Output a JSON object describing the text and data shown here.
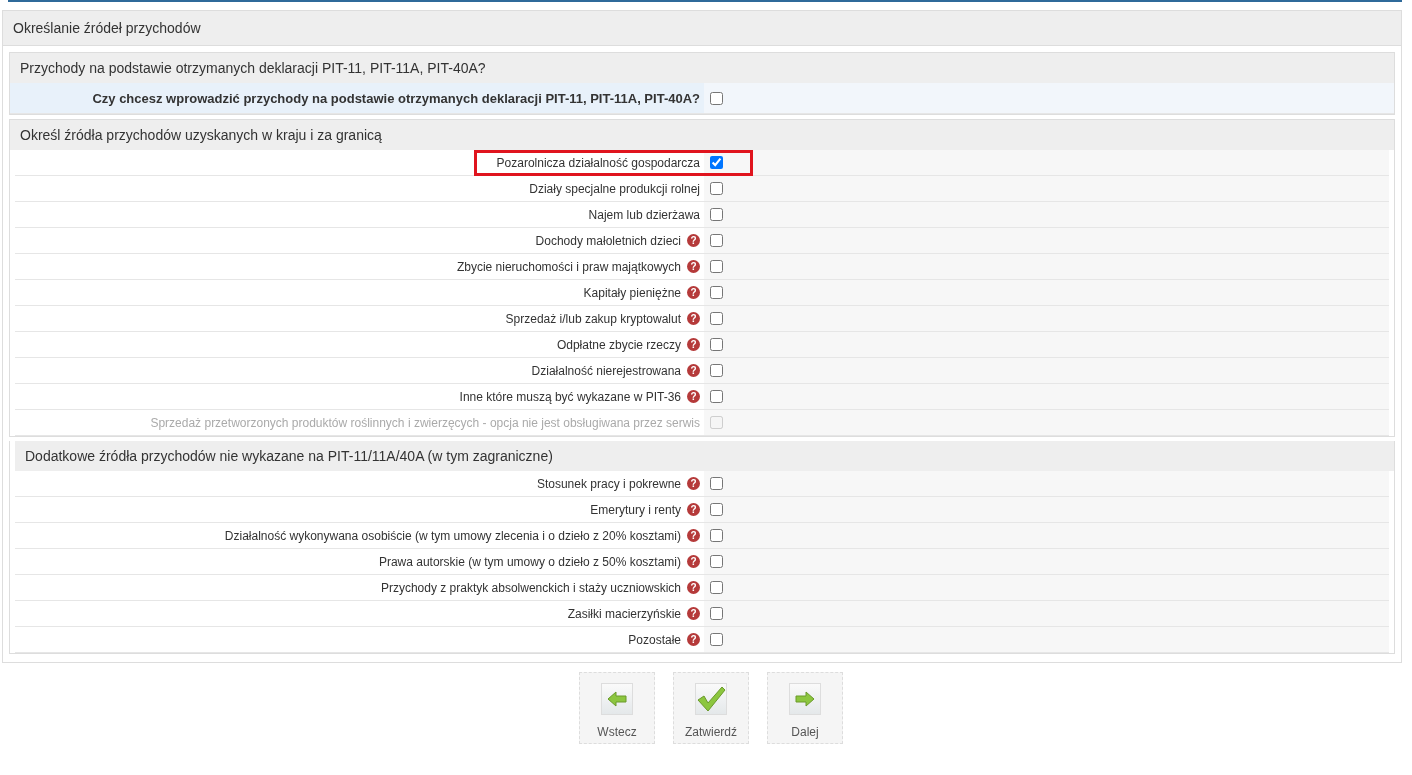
{
  "panel_title": "Określanie źródeł przychodów",
  "sections": [
    {
      "title": "Przychody na podstawie otrzymanych deklaracji PIT-11, PIT-11A, PIT-40A?",
      "rows": [
        {
          "kind": "question",
          "label": "Czy chcesz wprowadzić przychody na podstawie otrzymanych deklaracji PIT-11, PIT-11A, PIT-40A?",
          "checked": false,
          "disabled": false,
          "highlighted": false
        }
      ]
    },
    {
      "title": "Określ źródła przychodów uzyskanych w kraju i za granicą",
      "rows": [
        {
          "kind": "option",
          "label": "Pozarolnicza działalność gospodarcza",
          "checked": true,
          "disabled": false,
          "highlighted": true
        },
        {
          "kind": "option",
          "label": "Działy specjalne produkcji rolnej",
          "checked": false,
          "disabled": false,
          "highlighted": false
        },
        {
          "kind": "option",
          "label": "Najem lub dzierżawa",
          "checked": false,
          "disabled": false,
          "highlighted": false
        },
        {
          "kind": "option",
          "label": "Dochody małoletnich dzieci",
          "help": "?",
          "checked": false,
          "disabled": false,
          "highlighted": false
        },
        {
          "kind": "option",
          "label": "Zbycie nieruchomości i praw majątkowych",
          "help": "?",
          "checked": false,
          "disabled": false,
          "highlighted": false
        },
        {
          "kind": "option",
          "label": "Kapitały pieniężne",
          "help": "?",
          "checked": false,
          "disabled": false,
          "highlighted": false
        },
        {
          "kind": "option",
          "label": "Sprzedaż i/lub zakup kryptowalut",
          "help": "?",
          "checked": false,
          "disabled": false,
          "highlighted": false
        },
        {
          "kind": "option",
          "label": "Odpłatne zbycie rzeczy",
          "help": "?",
          "checked": false,
          "disabled": false,
          "highlighted": false
        },
        {
          "kind": "option",
          "label": "Działalność nierejestrowana",
          "help": "?",
          "checked": false,
          "disabled": false,
          "highlighted": false
        },
        {
          "kind": "option",
          "label": "Inne które muszą być wykazane w PIT-36",
          "help": "?",
          "checked": false,
          "disabled": false,
          "highlighted": false
        },
        {
          "kind": "option",
          "label": "Sprzedaż przetworzonych produktów roślinnych i zwierzęcych - opcja nie jest obsługiwana przez serwis",
          "checked": false,
          "disabled": true,
          "highlighted": false
        }
      ]
    },
    {
      "title": "Dodatkowe źródła przychodów nie wykazane na PIT-11/11A/40A (w tym zagraniczne)",
      "rows": [
        {
          "kind": "option",
          "label": "Stosunek pracy i pokrewne",
          "help": "?",
          "checked": false,
          "disabled": false,
          "highlighted": false
        },
        {
          "kind": "option",
          "label": "Emerytury i renty",
          "help": "?",
          "checked": false,
          "disabled": false,
          "highlighted": false
        },
        {
          "kind": "option",
          "label": "Działalność wykonywana osobiście (w tym umowy zlecenia i o dzieło z 20% kosztami)",
          "help": "?",
          "checked": false,
          "disabled": false,
          "highlighted": false
        },
        {
          "kind": "option",
          "label": "Prawa autorskie (w tym umowy o dzieło z 50% kosztami)",
          "help": "?",
          "checked": false,
          "disabled": false,
          "highlighted": false
        },
        {
          "kind": "option",
          "label": "Przychody z praktyk absolwenckich i staży uczniowskich",
          "help": "?",
          "checked": false,
          "disabled": false,
          "highlighted": false
        },
        {
          "kind": "option",
          "label": "Zasiłki macierzyńskie",
          "help": "?",
          "checked": false,
          "disabled": false,
          "highlighted": false
        },
        {
          "kind": "option",
          "label": "Pozostałe",
          "help": "?",
          "checked": false,
          "disabled": false,
          "highlighted": false
        }
      ]
    }
  ],
  "buttons": [
    {
      "kind": "back",
      "label": "Wstecz"
    },
    {
      "kind": "confirm",
      "label": "Zatwierdź"
    },
    {
      "kind": "next",
      "label": "Dalej"
    }
  ]
}
